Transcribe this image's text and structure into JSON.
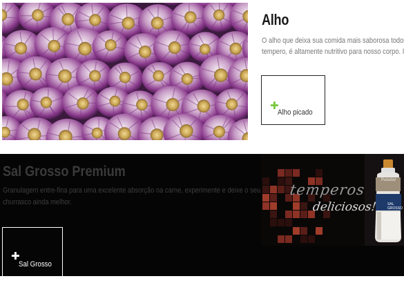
{
  "alho": {
    "title": "Alho",
    "description_line_1": "O alho que deixa sua comida mais saborosa todos os di",
    "description_line_2": "tempero, é altamente nutritivo para nosso corpo. Inclus",
    "button_label": "Alho picado",
    "button_icon": "plus-icon",
    "accent_color": "#7ac943"
  },
  "sal": {
    "title": "Sal Grosso Premium",
    "description_line_1": "Granulagem entre-fina para uma excelente absorção na carne, experimente e deixe o seu",
    "description_line_2": "churrasco ainda melhor.",
    "button_label": "Sal Grosso",
    "button_icon": "plus-icon"
  },
  "banner": {
    "headline_1": "temperos",
    "headline_2": "deliciosos!",
    "bottle_brand": "Paladar",
    "bottle_label": "SAL GROSSO"
  },
  "colors": {
    "dark_band": "#050505",
    "garlic_purple": "#8a3a8c"
  }
}
